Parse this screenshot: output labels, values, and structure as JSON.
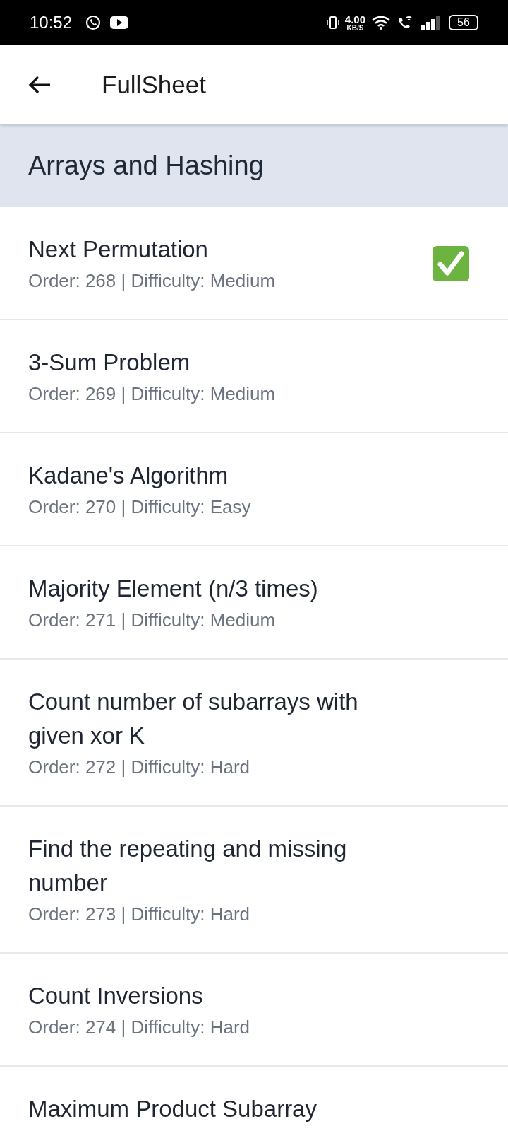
{
  "status_bar": {
    "time": "10:52",
    "speed": "4.00",
    "speed_unit": "KB/S",
    "battery": "56"
  },
  "app_bar": {
    "title": "FullSheet"
  },
  "section": {
    "title": "Arrays and Hashing"
  },
  "problems": [
    {
      "title": "Next Permutation",
      "meta": "Order: 268 | Difficulty: Medium",
      "solved": true
    },
    {
      "title": "3-Sum Problem",
      "meta": "Order: 269 | Difficulty: Medium",
      "solved": false
    },
    {
      "title": "Kadane's Algorithm",
      "meta": "Order: 270 | Difficulty: Easy",
      "solved": false
    },
    {
      "title": "Majority Element (n/3 times)",
      "meta": "Order: 271 | Difficulty: Medium",
      "solved": false
    },
    {
      "title": "Count number of subarrays with given xor K",
      "meta": "Order: 272 | Difficulty: Hard",
      "solved": false
    },
    {
      "title": "Find the repeating and missing number",
      "meta": "Order: 273 | Difficulty: Hard",
      "solved": false
    },
    {
      "title": "Count Inversions",
      "meta": "Order: 274 | Difficulty: Hard",
      "solved": false
    },
    {
      "title": "Maximum Product Subarray",
      "solved": false
    }
  ]
}
